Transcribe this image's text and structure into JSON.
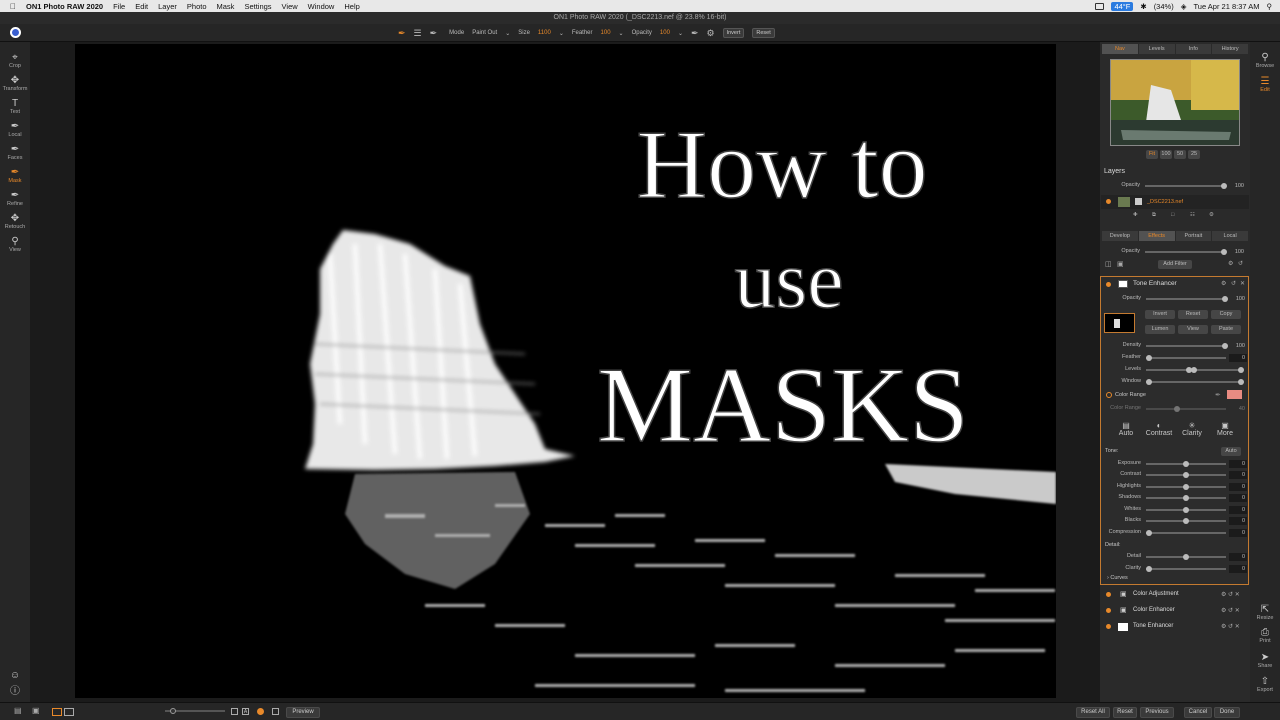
{
  "menubar": {
    "apple": "",
    "app": "ON1 Photo RAW 2020",
    "menus": [
      "File",
      "Edit",
      "Layer",
      "Photo",
      "Mask",
      "Settings",
      "View",
      "Window",
      "Help"
    ],
    "temperature": "44°F",
    "battery": "(34%)",
    "clock": "Tue Apr 21  8:37 AM"
  },
  "title": "ON1 Photo RAW 2020 (_DSC2213.nef @ 23.8% 16-bit)",
  "toolbar": {
    "mode_label": "Mode",
    "mode_value": "Paint Out",
    "size_label": "Size",
    "size_value": "1100",
    "feather_label": "Feather",
    "feather_value": "100",
    "opacity_label": "Opacity",
    "opacity_value": "100",
    "invert": "Invert",
    "reset": "Reset"
  },
  "lefttools": [
    "Crop",
    "Transform",
    "Text",
    "Local",
    "Faces",
    "Mask",
    "Refine",
    "Retouch",
    "View"
  ],
  "canvas_text": {
    "line1": "How to",
    "line2": "use",
    "line3": "MASKS"
  },
  "bottombar": {
    "preview": "Preview",
    "reset_all": "Reset All",
    "reset": "Reset",
    "previous": "Previous",
    "cancel": "Cancel",
    "done": "Done"
  },
  "panel": {
    "tabs": [
      "Nav",
      "Levels",
      "Info",
      "History"
    ],
    "zoom": [
      "Fit",
      "100",
      "50",
      "25"
    ],
    "layers_title": "Layers",
    "opacity_label": "Opacity",
    "opacity_value": "100",
    "layer_name": "_DSC2213.nef",
    "subtabs": [
      "Develop",
      "Effects",
      "Portrait",
      "Local"
    ],
    "effects_opacity_label": "Opacity",
    "effects_opacity_value": "100",
    "add_filter": "Add Filter",
    "filter_title": "Tone Enhancer",
    "filter_opacity_label": "Opacity",
    "filter_opacity_value": "100",
    "mask_buttons": [
      "Invert",
      "Reset",
      "Copy",
      "Lumen",
      "View",
      "Paste"
    ],
    "density_label": "Density",
    "density_value": "100",
    "feather_label": "Feather",
    "feather_value": "0",
    "levels_label": "Levels",
    "window_label": "Window",
    "window_value": "0",
    "color_range_label": "Color Range",
    "color_range_sub": "Color Range",
    "color_range_value": "40",
    "modes": [
      "Auto",
      "Contrast",
      "Clarity",
      "More"
    ],
    "tone_label": "Tone:",
    "auto": "Auto",
    "tone_sliders": [
      {
        "label": "Exposure",
        "value": "0"
      },
      {
        "label": "Contrast",
        "value": "0"
      },
      {
        "label": "Highlights",
        "value": "0"
      },
      {
        "label": "Shadows",
        "value": "0"
      },
      {
        "label": "Whites",
        "value": "0"
      },
      {
        "label": "Blacks",
        "value": "0"
      }
    ],
    "compression_label": "Compression",
    "compression_value": "0",
    "detail_label": "Detail:",
    "detail_slider_label": "Detail",
    "detail_slider_value": "0",
    "clarity_label": "Clarity",
    "clarity_value": "0",
    "curves": "Curves",
    "more_layers": [
      "Color Adjustment",
      "Color Enhancer",
      "Tone Enhancer"
    ]
  },
  "farright": [
    "Browse",
    "Edit",
    "Resize",
    "Print",
    "Share",
    "Export"
  ],
  "colors": {
    "accent": "#e8892a",
    "color_swatch": "#e98b82"
  }
}
